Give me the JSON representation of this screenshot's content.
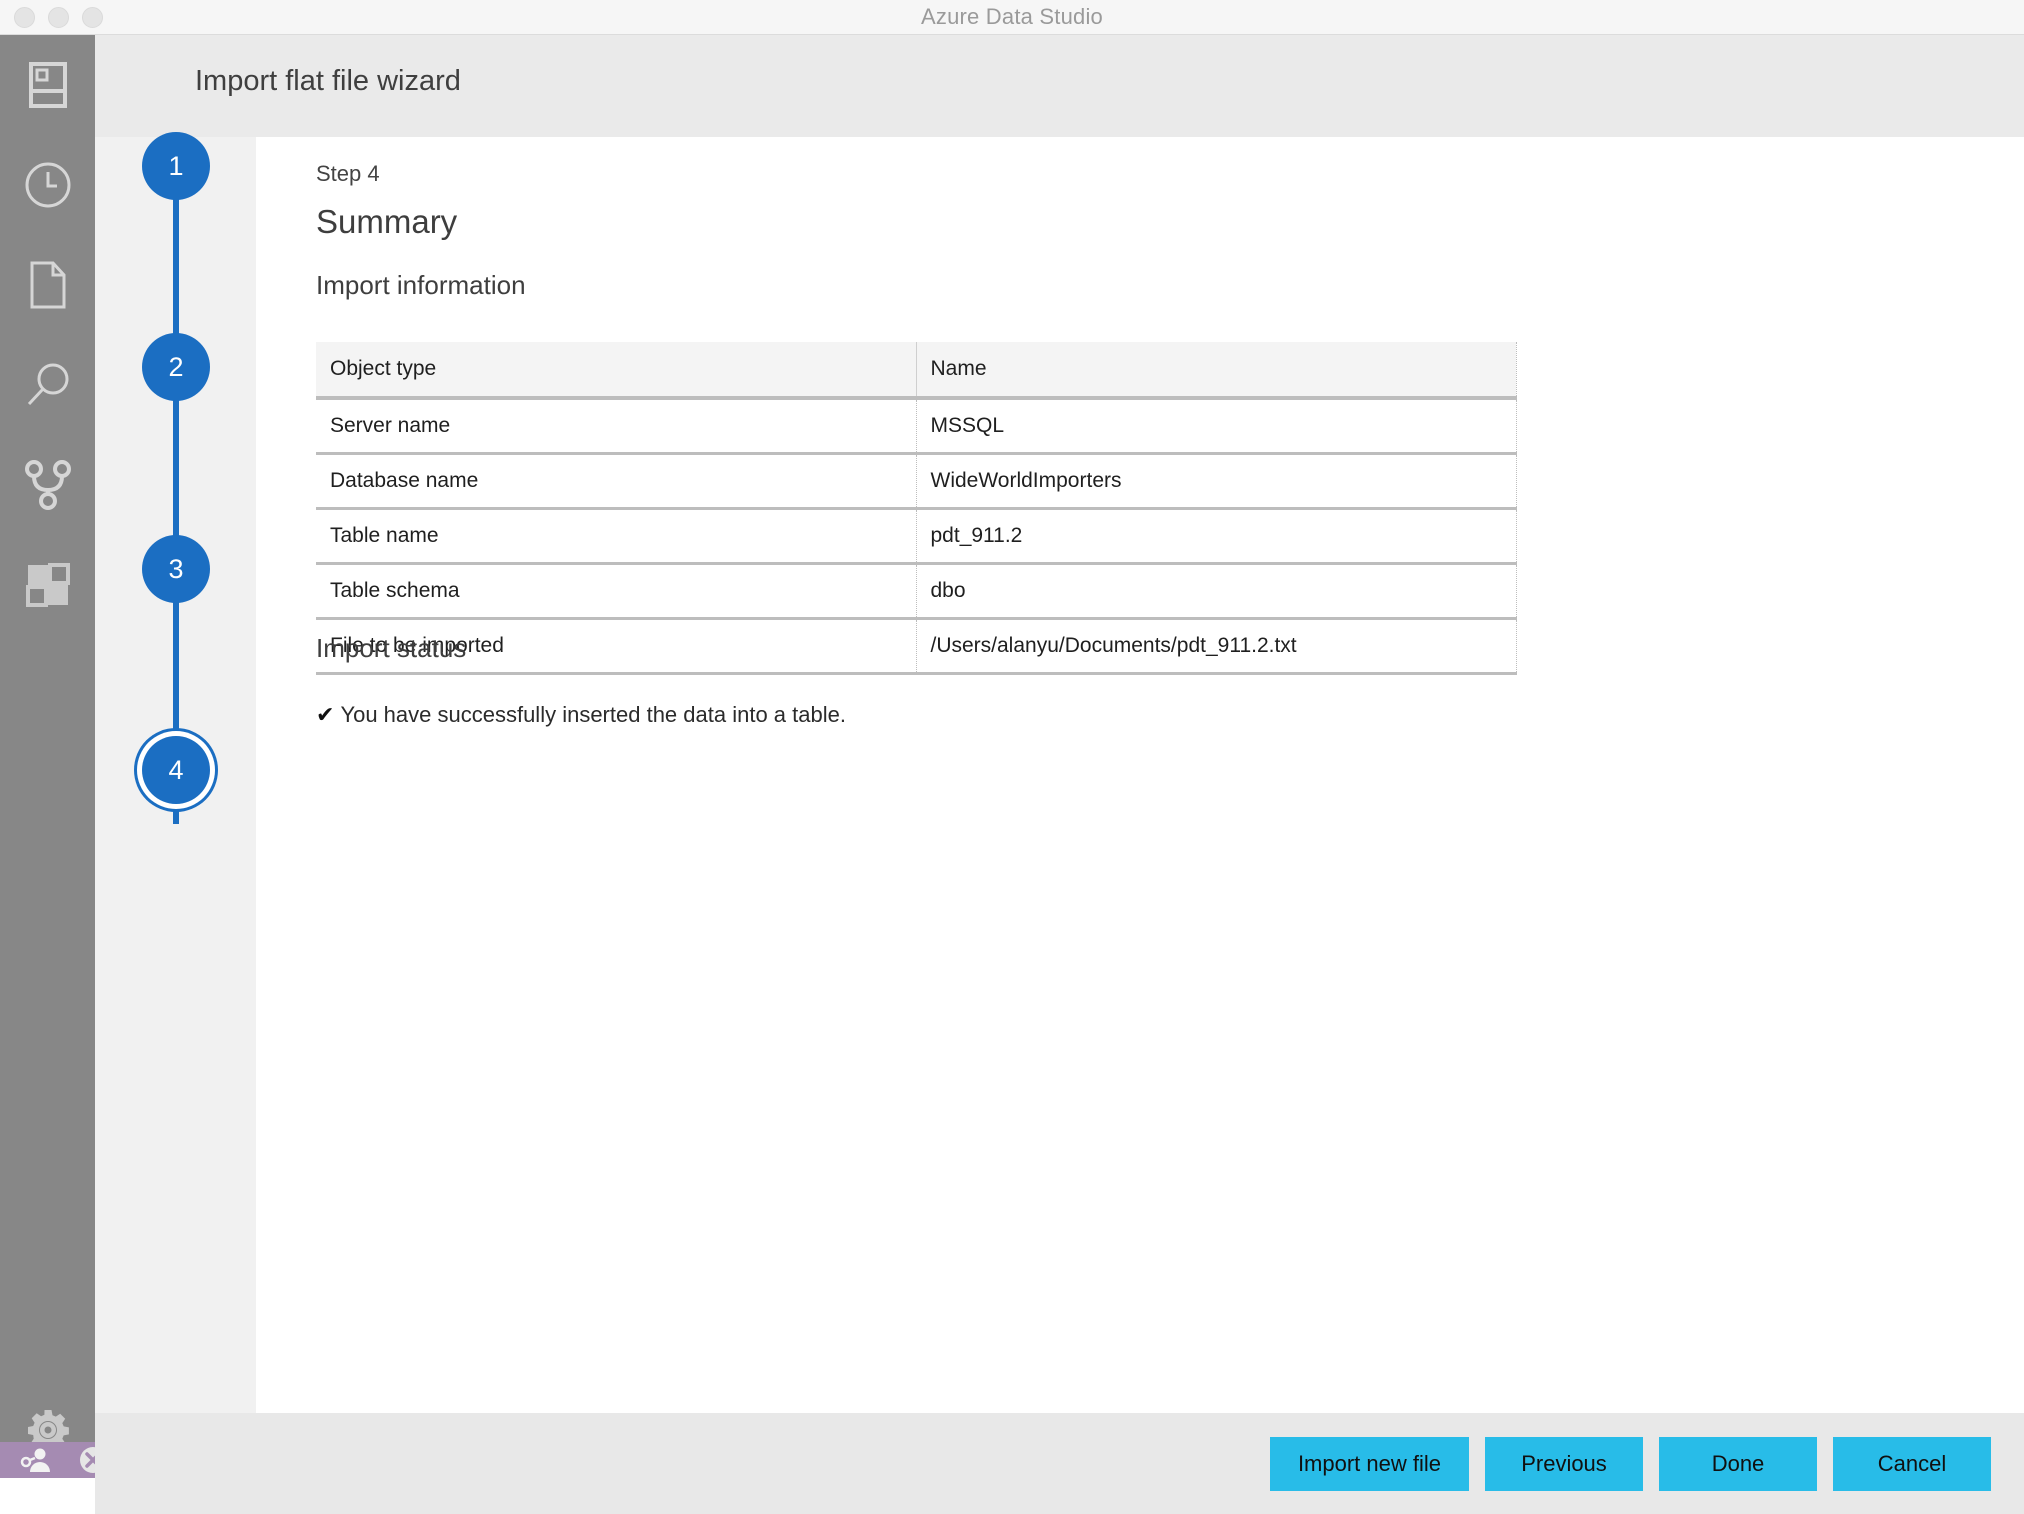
{
  "window": {
    "title": "Azure Data Studio",
    "traffic_lights": [
      "close-button",
      "minimize-button",
      "zoom-button"
    ]
  },
  "activity_bar": {
    "items": [
      {
        "name": "servers-icon",
        "label": "Servers"
      },
      {
        "name": "history-icon",
        "label": "History"
      },
      {
        "name": "notebook-file-icon",
        "label": "Notebooks"
      },
      {
        "name": "search-icon",
        "label": "Search"
      },
      {
        "name": "source-control-icon",
        "label": "Source Control"
      },
      {
        "name": "extensions-icon",
        "label": "Extensions"
      }
    ],
    "bottom_items": [
      {
        "name": "settings-gear-icon",
        "label": "Manage"
      }
    ],
    "status_bar": [
      {
        "name": "accounts-icon",
        "label": "Accounts"
      },
      {
        "name": "error-icon",
        "label": "Errors"
      }
    ]
  },
  "wizard": {
    "title": "Import flat file wizard",
    "steps": [
      {
        "number": "1",
        "active": false
      },
      {
        "number": "2",
        "active": false
      },
      {
        "number": "3",
        "active": false
      },
      {
        "number": "4",
        "active": true
      }
    ],
    "step_label": "Step 4",
    "page_title": "Summary",
    "import_information": {
      "heading": "Import information",
      "columns": [
        "Object type",
        "Name"
      ],
      "rows": [
        [
          "Server name",
          "MSSQL"
        ],
        [
          "Database name",
          "WideWorldImporters"
        ],
        [
          "Table name",
          "pdt_911.2"
        ],
        [
          "Table schema",
          "dbo"
        ],
        [
          "File to be imported",
          "/Users/alanyu/Documents/pdt_911.2.txt"
        ]
      ]
    },
    "import_status": {
      "heading": "Import status",
      "check_glyph": "✔",
      "message": "You have successfully inserted the data into a table."
    },
    "buttons": [
      {
        "name": "import-new-file-button",
        "label": "Import new file"
      },
      {
        "name": "previous-button",
        "label": "Previous"
      },
      {
        "name": "done-button",
        "label": "Done"
      },
      {
        "name": "cancel-button",
        "label": "Cancel"
      }
    ]
  },
  "colors": {
    "accent_blue": "#1b6ec2",
    "button_cyan": "#28bce8",
    "activity_bar": "#878787",
    "status_bar_purple": "#a58bb2",
    "header_gray": "#eaeaea"
  }
}
